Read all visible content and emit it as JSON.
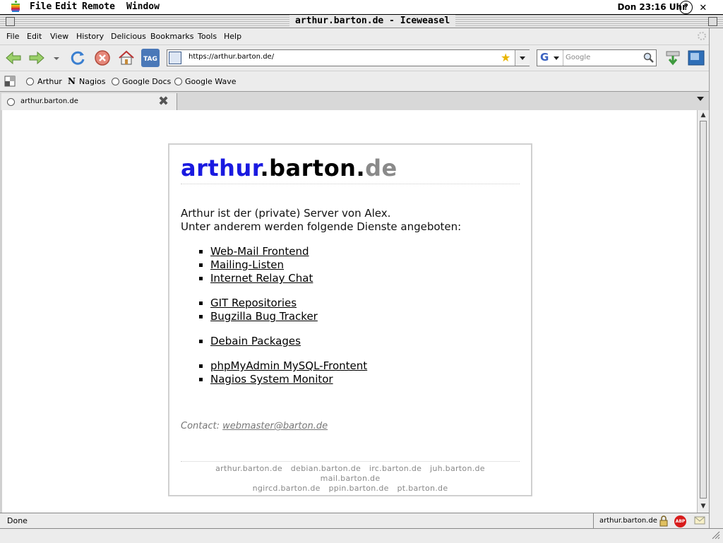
{
  "os_menubar": {
    "items": [
      "File",
      "Edit",
      "Remote",
      "Window"
    ],
    "clock": "Don 23:16 Uhr",
    "help_glyph": "?",
    "close_glyph": "✕"
  },
  "window": {
    "title": "arthur.barton.de - Iceweasel"
  },
  "app_menu": {
    "items": [
      "File",
      "Edit",
      "View",
      "History",
      "Delicious",
      "Bookmarks",
      "Tools",
      "Help"
    ]
  },
  "navbar": {
    "url": "https://arthur.barton.de/",
    "search_placeholder": "Google",
    "tag_label": "TAG"
  },
  "bookmarks": [
    "Arthur",
    "Nagios",
    "Google Docs",
    "Google Wave"
  ],
  "tab": {
    "label": "arthur.barton.de"
  },
  "page": {
    "title_part1": "arthur",
    "title_part2": ".barton.",
    "title_part3": "de",
    "intro_line1": "Arthur ist der (private) Server von Alex.",
    "intro_line2": "Unter anderem werden folgende Dienste angeboten:",
    "groups": [
      [
        "Web-Mail Frontend",
        "Mailing-Listen",
        "Internet Relay Chat"
      ],
      [
        "GIT Repositories",
        "Bugzilla Bug Tracker"
      ],
      [
        "Debain Packages"
      ],
      [
        "phpMyAdmin MySQL-Frontent",
        "Nagios System Monitor"
      ]
    ],
    "contact_label": "Contact:",
    "contact_email": "webmaster@barton.de",
    "footer_row1": [
      "arthur.barton.de",
      "debian.barton.de",
      "irc.barton.de",
      "juh.barton.de",
      "mail.barton.de"
    ],
    "footer_row2": [
      "ngircd.barton.de",
      "ppin.barton.de",
      "pt.barton.de"
    ]
  },
  "statusbar": {
    "status": "Done",
    "host": "arthur.barton.de",
    "abp_label": "ABP"
  },
  "colors": {
    "title_blue": "#1a1ae0",
    "title_grey": "#8a8a8a",
    "chrome_bg": "#ececec"
  }
}
